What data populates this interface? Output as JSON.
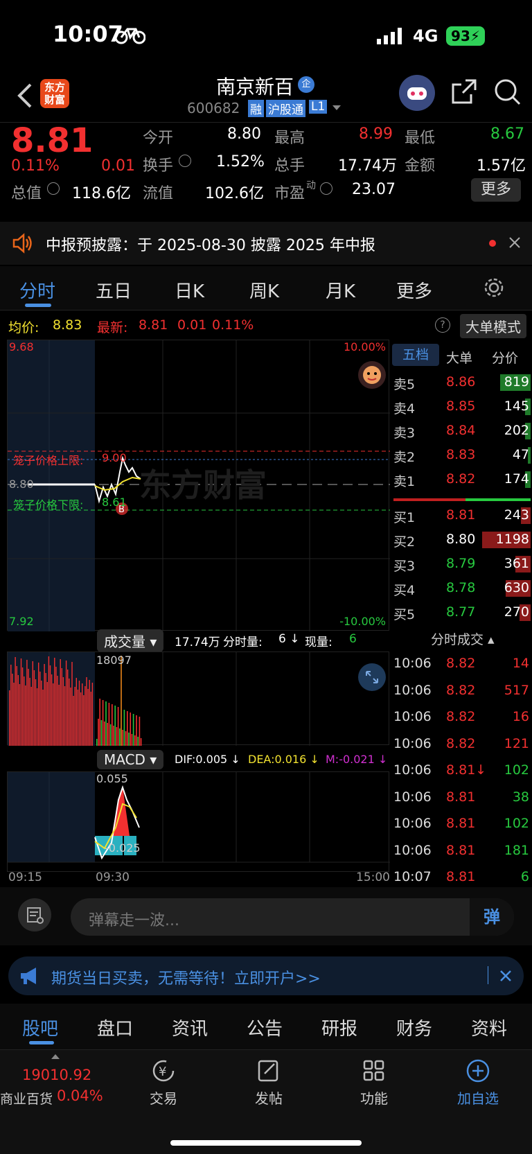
{
  "status": {
    "time": "10:07",
    "network": "4G",
    "battery": "93"
  },
  "nav": {
    "stock_name": "南京新百",
    "stock_code": "600682",
    "badge_rong": "融",
    "badge_hgt": "沪股通",
    "badge_level": "L1",
    "logo_line1": "东方",
    "logo_line2": "财富",
    "enterprise_badge": "企"
  },
  "quote": {
    "price": "8.81",
    "pct": "0.11%",
    "chg": "0.01",
    "open_label": "今开",
    "open": "8.80",
    "high_label": "最高",
    "high": "8.99",
    "low_label": "最低",
    "low": "8.67",
    "turnover_label": "换手",
    "turnover": "1.52%",
    "volume_label": "总手",
    "volume": "17.74万",
    "amount_label": "金额",
    "amount": "1.57亿",
    "mcap_label": "总值",
    "mcap": "118.6亿",
    "float_label": "流值",
    "float": "102.6亿",
    "pe_label": "市盈",
    "pe_sup": "动",
    "pe": "23.07",
    "more": "更多"
  },
  "notice": {
    "text": "中报预披露：于 2025-08-30 披露 2025 年中报"
  },
  "tabs": [
    "分时",
    "五日",
    "日K",
    "周K",
    "月K",
    "更多"
  ],
  "infobar": {
    "avg_label": "均价:",
    "avg": "8.83",
    "latest_label": "最新:",
    "latest": "8.81",
    "chg": "0.01",
    "pct": "0.11%",
    "mode": "大单模式"
  },
  "chart": {
    "high": "9.68",
    "low": "7.92",
    "pct_high": "10.00%",
    "pct_low": "-10.00%",
    "upper_label": "笼子价格上限:",
    "upper_val": "9.00",
    "lower_label": "笼子价格下限:",
    "lower_val": "8.61",
    "mid": "8.80",
    "watermark": "东方财富",
    "marker": "B"
  },
  "book": {
    "tabs": [
      "五档",
      "大单",
      "分价"
    ],
    "asks": [
      {
        "l": "卖5",
        "p": "8.86",
        "v": "819"
      },
      {
        "l": "卖4",
        "p": "8.85",
        "v": "145"
      },
      {
        "l": "卖3",
        "p": "8.84",
        "v": "202"
      },
      {
        "l": "卖2",
        "p": "8.83",
        "v": "47"
      },
      {
        "l": "卖1",
        "p": "8.82",
        "v": "174"
      }
    ],
    "bids": [
      {
        "l": "买1",
        "p": "8.81",
        "v": "243"
      },
      {
        "l": "买2",
        "p": "8.80",
        "v": "1198"
      },
      {
        "l": "买3",
        "p": "8.79",
        "v": "361"
      },
      {
        "l": "买4",
        "p": "8.78",
        "v": "630"
      },
      {
        "l": "买5",
        "p": "8.77",
        "v": "270"
      }
    ],
    "ticks_title": "分时成交",
    "ticks": [
      {
        "t": "10:06",
        "p": "8.82",
        "v": "14"
      },
      {
        "t": "10:06",
        "p": "8.82",
        "v": "517"
      },
      {
        "t": "10:06",
        "p": "8.82",
        "v": "16"
      },
      {
        "t": "10:06",
        "p": "8.82",
        "v": "121"
      },
      {
        "t": "10:06",
        "p": "8.81↓",
        "v": "102"
      },
      {
        "t": "10:06",
        "p": "8.81",
        "v": "38"
      },
      {
        "t": "10:06",
        "p": "8.81",
        "v": "102"
      },
      {
        "t": "10:06",
        "p": "8.81",
        "v": "181"
      },
      {
        "t": "10:07",
        "p": "8.81",
        "v": "6"
      }
    ]
  },
  "volume": {
    "label": "成交量",
    "total": "17.74万",
    "fenshi_label": "分时量:",
    "fenshi": "6 ↓",
    "xianliang_label": "现量:",
    "xianliang": "6",
    "max": "18097"
  },
  "macd": {
    "label": "MACD",
    "dif": "DIF:0.005 ↓",
    "dea": "DEA:0.016 ↓",
    "m": "M:-0.021 ↓",
    "top": "0.055",
    "bottom": "-0.025"
  },
  "axis": {
    "t1": "09:15",
    "t2": "09:30",
    "t3": "15:00"
  },
  "comment": {
    "placeholder": "弹幕走一波...",
    "danmu": "弹"
  },
  "ad": {
    "text": "期货当日买卖，无需等待！立即开户>>"
  },
  "bottom_tabs": [
    "股吧",
    "盘口",
    "资讯",
    "公告",
    "研报",
    "财务",
    "资料"
  ],
  "dock": {
    "index_value": "19010.92",
    "index_name": "商业百货",
    "index_pct": "0.04%",
    "trade": "交易",
    "post": "发帖",
    "func": "功能",
    "add": "加自选"
  }
}
